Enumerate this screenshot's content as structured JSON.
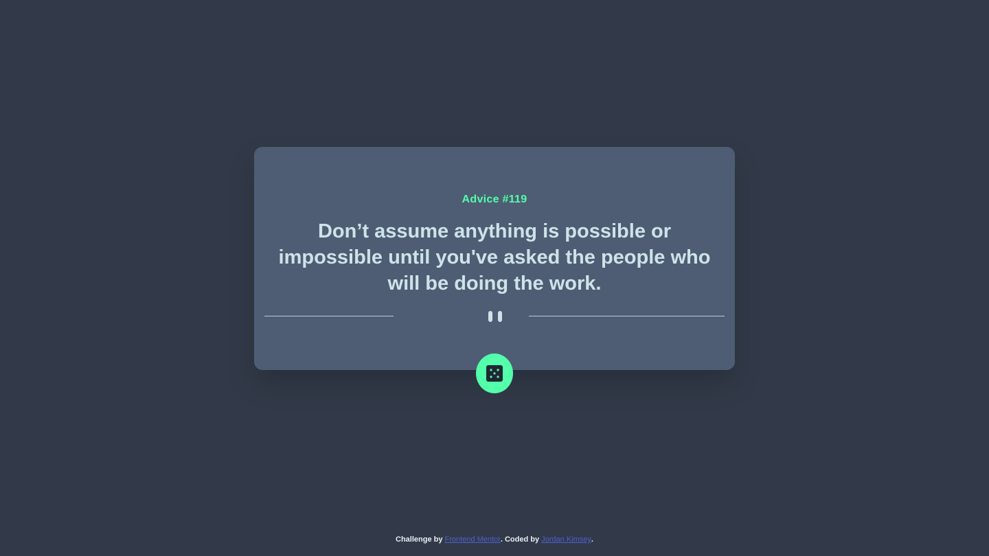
{
  "advice": {
    "id_label": "Advice #119",
    "text": "Don’t assume anything is possible or impossible until you've asked the people who will be doing the work."
  },
  "icons": {
    "divider": "pause-icon",
    "button": "dice-icon"
  },
  "footer": {
    "challenge_prefix": "Challenge by ",
    "challenge_link": "Frontend Mentor",
    "coded_prefix": ". Coded by ",
    "coded_link": "Jordan Kimsey",
    "suffix": "."
  },
  "colors": {
    "background": "#323a49",
    "card": "#4e5d73",
    "accent": "#53ffaa",
    "text": "#cee3e9",
    "link": "#4f5fd0"
  }
}
